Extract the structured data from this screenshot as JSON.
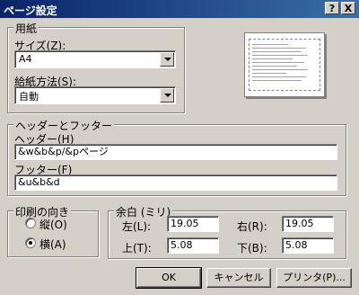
{
  "window": {
    "title": "ページ設定",
    "help_glyph": "?",
    "close_glyph": "X"
  },
  "paper": {
    "group_label": "用紙",
    "size_label": "サイズ(Z):",
    "size_value": "A4",
    "source_label": "給紙方法(S):",
    "source_value": "自動"
  },
  "header_footer": {
    "group_label": "ヘッダーとフッター",
    "header_label": "ヘッダー(H)",
    "header_value": "&w&b&p/&pページ",
    "footer_label": "フッター(F)",
    "footer_value": "&u&b&d"
  },
  "orientation": {
    "group_label": "印刷の向き",
    "portrait_label": "縦(O)",
    "landscape_label": "横(A)",
    "selected": "landscape"
  },
  "margins": {
    "group_label": "余白 (ミリ)",
    "left_label": "左(L):",
    "left_value": "19.05",
    "right_label": "右(R):",
    "right_value": "19.05",
    "top_label": "上(T):",
    "top_value": "5.08",
    "bottom_label": "下(B):",
    "bottom_value": "5.08"
  },
  "buttons": {
    "ok": "OK",
    "cancel": "キャンセル",
    "printer": "プリンタ(P)..."
  }
}
